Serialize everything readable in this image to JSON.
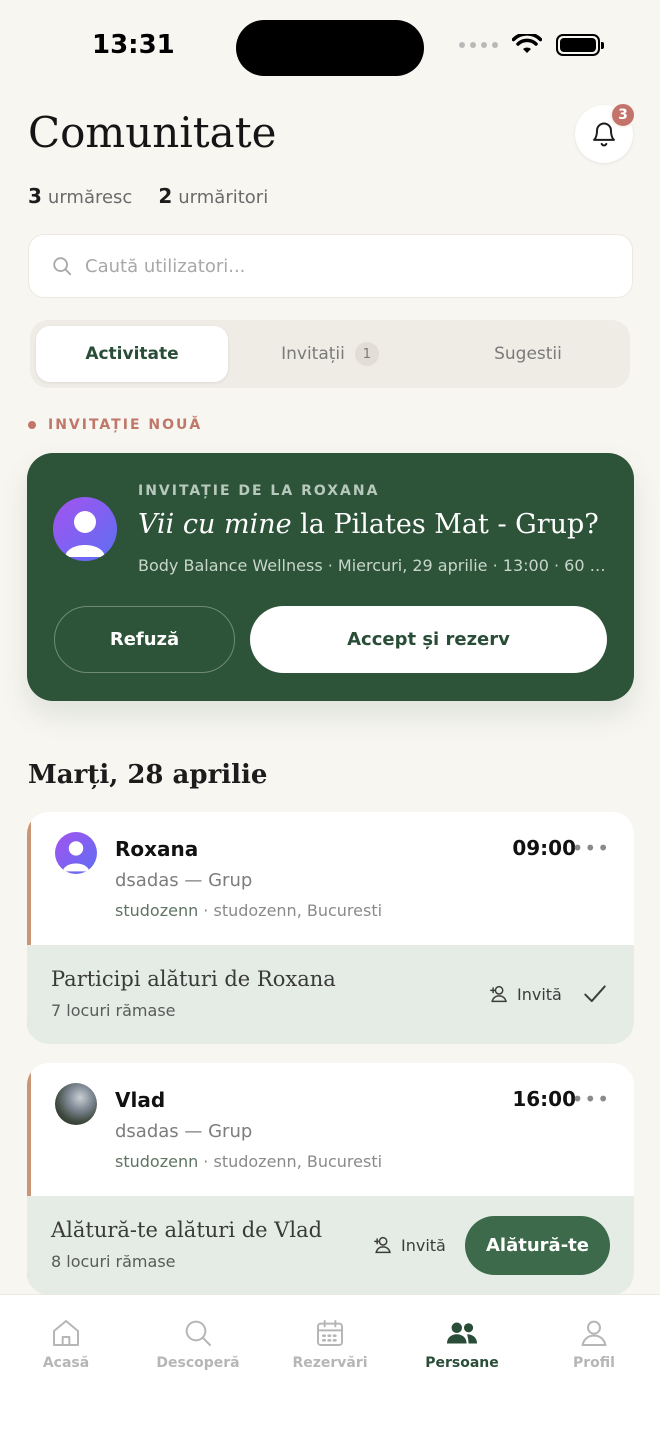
{
  "status_bar": {
    "time": "13:31"
  },
  "header": {
    "title": "Comunitate",
    "notification_count": "3",
    "following_count": "3",
    "following_label": "urmăresc",
    "followers_count": "2",
    "followers_label": "urmăritori"
  },
  "search": {
    "placeholder": "Caută utilizatori..."
  },
  "tabs": [
    {
      "label": "Activitate",
      "active": true
    },
    {
      "label": "Invitații",
      "count": "1"
    },
    {
      "label": "Sugestii"
    }
  ],
  "new_invitation": {
    "section_label": "INVITAȚIE NOUĂ",
    "from": "INVITAȚIE DE LA ROXANA",
    "title_italic": "Vii cu mine",
    "title_rest": " la Pilates Mat - Grup?",
    "details": "Body Balance Wellness · Miercuri, 29 aprilie · 13:00 · 60 R...",
    "refuse_label": "Refuză",
    "accept_label": "Accept și rezerv"
  },
  "day_heading": "Marți, 28 aprilie",
  "activities": [
    {
      "name": "Roxana",
      "time": "09:00",
      "class": "dsadas — Grup",
      "studio": "studozenn",
      "location": " · studozenn, Bucuresti",
      "status": "Participi alături de Roxana",
      "spots": "7 locuri rămase",
      "invite_label": "Invită"
    },
    {
      "name": "Vlad",
      "time": "16:00",
      "class": "dsadas — Grup",
      "studio": "studozenn",
      "location": " · studozenn, Bucuresti",
      "status": "Alătură-te alături de Vlad",
      "spots": "8 locuri rămase",
      "invite_label": "Invită",
      "join_label": "Alătură-te"
    }
  ],
  "bottom_nav": [
    {
      "label": "Acasă",
      "icon": "home-icon"
    },
    {
      "label": "Descoperă",
      "icon": "search-icon"
    },
    {
      "label": "Rezervări",
      "icon": "calendar-icon"
    },
    {
      "label": "Persoane",
      "icon": "people-icon",
      "active": true
    },
    {
      "label": "Profil",
      "icon": "user-icon"
    }
  ],
  "colors": {
    "background": "#f8f6f1",
    "primary_green": "#2d5339",
    "accent_terracotta": "#c0776a",
    "badge": "#c4736a",
    "card_bottom": "#e4ece5"
  }
}
